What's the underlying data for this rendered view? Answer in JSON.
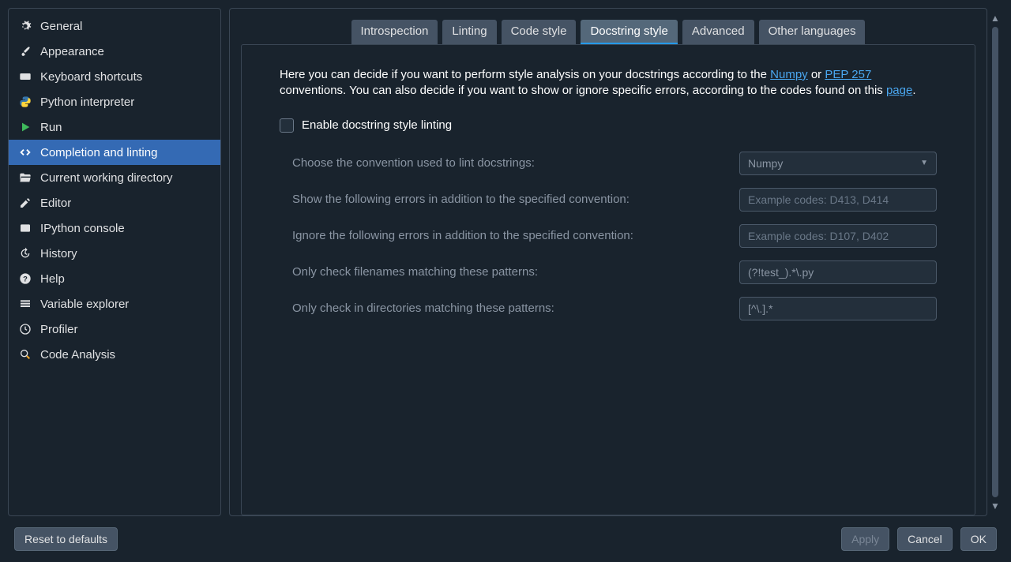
{
  "sidebar": {
    "items": [
      {
        "label": "General"
      },
      {
        "label": "Appearance"
      },
      {
        "label": "Keyboard shortcuts"
      },
      {
        "label": "Python interpreter"
      },
      {
        "label": "Run"
      },
      {
        "label": "Completion and linting"
      },
      {
        "label": "Current working directory"
      },
      {
        "label": "Editor"
      },
      {
        "label": "IPython console"
      },
      {
        "label": "History"
      },
      {
        "label": "Help"
      },
      {
        "label": "Variable explorer"
      },
      {
        "label": "Profiler"
      },
      {
        "label": "Code Analysis"
      }
    ]
  },
  "tabs": [
    {
      "label": "Introspection"
    },
    {
      "label": "Linting"
    },
    {
      "label": "Code style"
    },
    {
      "label": "Docstring style"
    },
    {
      "label": "Advanced"
    },
    {
      "label": "Other languages"
    }
  ],
  "intro": {
    "part1": "Here you can decide if you want to perform style analysis on your docstrings according to the ",
    "link1": "Numpy",
    "part2": " or ",
    "link2": "PEP 257",
    "part3": " conventions. You can also decide if you want to show or ignore specific errors, according to the codes found on this ",
    "link3": "page",
    "part4": "."
  },
  "enable_label": "Enable docstring style linting",
  "form": {
    "convention": {
      "label": "Choose the convention used to lint docstrings:",
      "value": "Numpy"
    },
    "show_errors": {
      "label": "Show the following errors in addition to the specified convention:",
      "placeholder": "Example codes: D413, D414",
      "value": ""
    },
    "ignore_errors": {
      "label": "Ignore the following errors in addition to the specified convention:",
      "placeholder": "Example codes: D107, D402",
      "value": ""
    },
    "filenames": {
      "label": "Only check filenames matching these patterns:",
      "value": "(?!test_).*\\.py"
    },
    "directories": {
      "label": "Only check in directories matching these patterns:",
      "value": "[^\\.].*"
    }
  },
  "footer": {
    "reset": "Reset to defaults",
    "apply": "Apply",
    "cancel": "Cancel",
    "ok": "OK"
  }
}
